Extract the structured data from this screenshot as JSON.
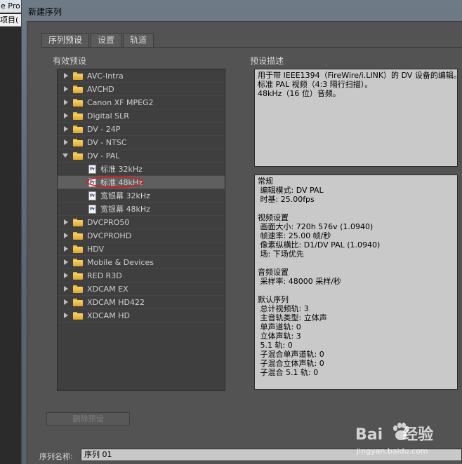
{
  "app": {
    "title": "e Pro",
    "menu_item": "项目("
  },
  "window": {
    "title": "新建序列"
  },
  "tabs": [
    {
      "label": "序列预设"
    },
    {
      "label": "设置"
    },
    {
      "label": "轨道"
    }
  ],
  "presets_label": "有效预设",
  "description_label": "预设描述",
  "tree": {
    "items": [
      {
        "label": "AVC-Intra",
        "type": "folder",
        "expanded": false
      },
      {
        "label": "AVCHD",
        "type": "folder",
        "expanded": false
      },
      {
        "label": "Canon XF MPEG2",
        "type": "folder",
        "expanded": false
      },
      {
        "label": "Digital SLR",
        "type": "folder",
        "expanded": false
      },
      {
        "label": "DV - 24P",
        "type": "folder",
        "expanded": false
      },
      {
        "label": "DV - NTSC",
        "type": "folder",
        "expanded": false
      },
      {
        "label": "DV - PAL",
        "type": "folder",
        "expanded": true
      },
      {
        "label": "标准 32kHz",
        "type": "preset"
      },
      {
        "label": "标准 48kHz",
        "type": "preset",
        "selected": true
      },
      {
        "label": "宽银幕 32kHz",
        "type": "preset"
      },
      {
        "label": "宽银幕 48kHz",
        "type": "preset"
      },
      {
        "label": "DVCPRO50",
        "type": "folder",
        "expanded": false
      },
      {
        "label": "DVCPROHD",
        "type": "folder",
        "expanded": false
      },
      {
        "label": "HDV",
        "type": "folder",
        "expanded": false
      },
      {
        "label": "Mobile & Devices",
        "type": "folder",
        "expanded": false
      },
      {
        "label": "RED R3D",
        "type": "folder",
        "expanded": false
      },
      {
        "label": "XDCAM EX",
        "type": "folder",
        "expanded": false
      },
      {
        "label": "XDCAM HD422",
        "type": "folder",
        "expanded": false
      },
      {
        "label": "XDCAM HD",
        "type": "folder",
        "expanded": false
      }
    ]
  },
  "description": {
    "text": "用于带 IEEE1394（FireWire/i.LINK）的 DV 设备的编辑。\n标准 PAL 视频（4:3 隔行扫描）。\n48kHz（16 位）音频。"
  },
  "details": {
    "text": "常规\n 编辑模式: DV PAL\n 时基: 25.00fps\n\n视频设置\n 画面大小: 720h 576v (1.0940)\n 帧速率: 25.00 帧/秒\n 像素纵横比: D1/DV PAL (1.0940)\n 场: 下场优先\n\n音频设置\n 采样率: 48000 采样/秒\n\n默认序列\n 总计视频轨: 3\n 主音轨类型: 立体声\n 单声道轨: 0\n 立体声轨: 3\n 5.1 轨: 0\n 子混合单声道轨: 0\n 子混合立体声轨: 0\n 子混合 5.1 轨: 0"
  },
  "delete_button_label": "删除预设",
  "sequence_name": {
    "label": "序列名称:",
    "value": "序列 01"
  },
  "watermark": {
    "brand": "Bai",
    "brand_suffix": "经验",
    "url": "jingyan.baidu.com"
  },
  "colors": {
    "dialog_bg": "#535353",
    "tree_bg": "#3f3f3f",
    "desc_bg": "#c9c9c9",
    "folder": "#e8b73a",
    "highlight": "#d21e1e"
  }
}
